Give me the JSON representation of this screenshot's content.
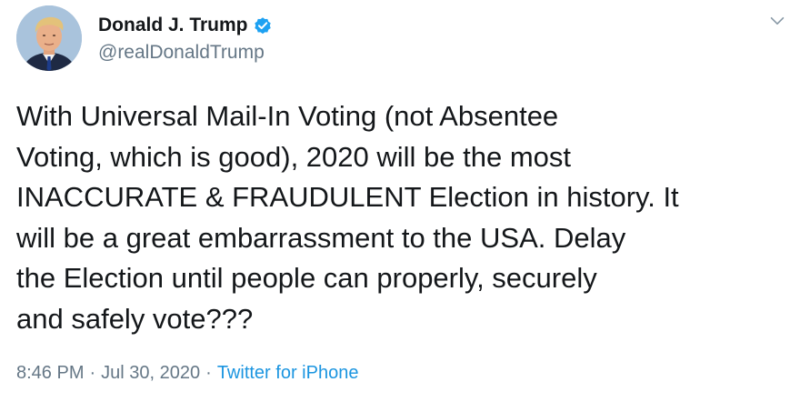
{
  "author": {
    "display_name": "Donald J. Trump",
    "handle": "@realDonaldTrump",
    "verified": true,
    "avatar_icon": "profile-photo"
  },
  "tweet": {
    "lines": [
      "With Universal Mail-In Voting (not Absentee",
      "Voting, which is good), 2020 will be the most",
      "INACCURATE & FRAUDULENT Election in history. It",
      "will be a great embarrassment to the USA. Delay",
      "the Election until people can properly, securely",
      "and safely vote???"
    ],
    "time": "8:46 PM",
    "separator": "·",
    "date": "Jul 30, 2020",
    "source": "Twitter for iPhone"
  },
  "icons": {
    "verified": "verified-badge-icon",
    "caret": "chevron-down-icon"
  },
  "colors": {
    "text": "#14171a",
    "secondary": "#657786",
    "link": "#1b95e0",
    "verified": "#1da1f2"
  }
}
